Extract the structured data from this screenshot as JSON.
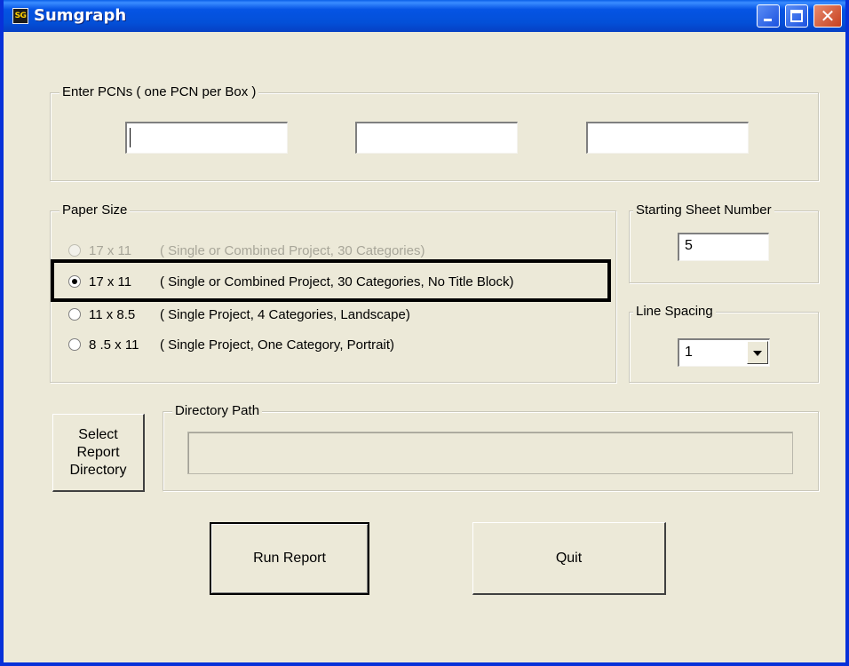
{
  "window": {
    "title": "Sumgraph",
    "icon_text": "SG",
    "icon": "sumgraph-app-icon",
    "controls": {
      "minimize_icon": "minimize-icon",
      "maximize_icon": "maximize-icon",
      "close_icon": "close-icon",
      "close_glyph": "✕"
    }
  },
  "pcn_group": {
    "legend": "Enter PCNs ( one PCN per Box )",
    "fields": [
      {
        "value": ""
      },
      {
        "value": ""
      },
      {
        "value": ""
      }
    ]
  },
  "paper_size": {
    "legend": "Paper Size",
    "options": [
      {
        "size": "17 x 11",
        "desc": "( Single or Combined Project, 30 Categories)",
        "checked": false,
        "disabled": true
      },
      {
        "size": "17 x 11",
        "desc": "( Single or Combined Project, 30 Categories, No Title Block)",
        "checked": true,
        "disabled": false
      },
      {
        "size": "11 x 8.5",
        "desc": "( Single Project, 4 Categories, Landscape)",
        "checked": false,
        "disabled": false
      },
      {
        "size": "8 .5 x 11",
        "desc": "( Single Project, One Category, Portrait)",
        "checked": false,
        "disabled": false
      }
    ]
  },
  "starting_sheet": {
    "legend": "Starting Sheet Number",
    "value": "5"
  },
  "line_spacing": {
    "legend": "Line Spacing",
    "value": "1"
  },
  "report_dir": {
    "select_button": "Select\nReport\nDirectory",
    "path_legend": "Directory Path",
    "path_value": ""
  },
  "actions": {
    "run": "Run Report",
    "quit": "Quit"
  },
  "colors": {
    "title_bar": "#0554e4",
    "window_face": "#ece9d8",
    "close_button": "#c8401f"
  }
}
